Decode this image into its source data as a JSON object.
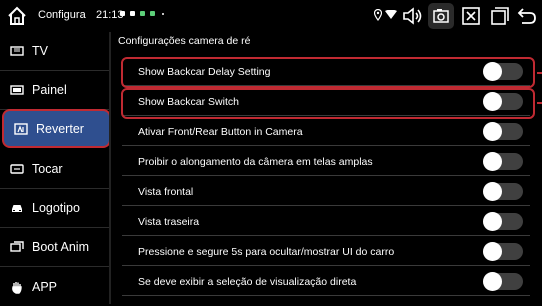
{
  "statusbar": {
    "title": "Configura",
    "time": "21:13",
    "icons": [
      "home-icon",
      "location-icon",
      "wifi-icon",
      "volume-icon",
      "screenshot-icon",
      "close-box-icon",
      "windows-icon",
      "back-icon"
    ]
  },
  "sidebar": {
    "items": [
      {
        "label": "TV",
        "icon": "tv-icon",
        "active": false
      },
      {
        "label": "Painel",
        "icon": "panel-icon",
        "active": false
      },
      {
        "label": "Reverter",
        "icon": "reverse-camera-icon",
        "active": true
      },
      {
        "label": "Tocar",
        "icon": "touch-icon",
        "active": false
      },
      {
        "label": "Logotipo",
        "icon": "car-icon",
        "active": false
      },
      {
        "label": "Boot Anim",
        "icon": "boot-anim-icon",
        "active": false
      },
      {
        "label": "APP",
        "icon": "hand-icon",
        "active": false
      }
    ]
  },
  "content": {
    "title": "Configurações camera de ré",
    "settings": [
      {
        "label": "Show Backcar Delay Setting",
        "on": false
      },
      {
        "label": "Show Backcar Switch",
        "on": false
      },
      {
        "label": "Ativar Front/Rear Button in Camera",
        "on": false
      },
      {
        "label": "Proibir o alongamento da câmera em telas amplas",
        "on": false
      },
      {
        "label": "Vista frontal",
        "on": false
      },
      {
        "label": "Vista traseira",
        "on": false
      },
      {
        "label": "Pressione e segure 5s para ocultar/mostrar UI do carro",
        "on": false
      },
      {
        "label": "Se deve exibir a seleção de visualização direta",
        "on": false
      }
    ]
  },
  "colors": {
    "highlight": "#c02a32",
    "active_bg": "#2f4f8f",
    "toggle_track": "#404040"
  }
}
